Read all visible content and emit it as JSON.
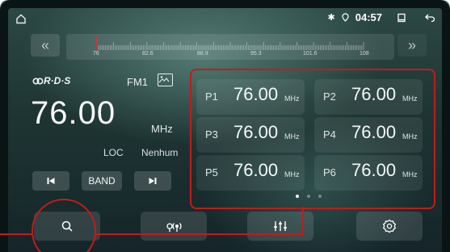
{
  "status": {
    "time": "04:57",
    "icons": [
      "home-icon",
      "bluetooth-icon",
      "location-icon",
      "window-icon",
      "back-icon"
    ]
  },
  "tuner": {
    "scale_labels": [
      "76",
      "82.6",
      "88.9",
      "95.3",
      "101.6",
      "108"
    ],
    "current_marker": 76
  },
  "station": {
    "rds_logo": "RDS",
    "band": "FM1",
    "frequency": "76.00",
    "unit": "MHz",
    "loc": "LOC",
    "ps_name": "Nenhum"
  },
  "controls": {
    "band_label": "BAND"
  },
  "presets": [
    {
      "id": "P1",
      "freq": "76.00",
      "unit": "MHz"
    },
    {
      "id": "P2",
      "freq": "76.00",
      "unit": "MHz"
    },
    {
      "id": "P3",
      "freq": "76.00",
      "unit": "MHz"
    },
    {
      "id": "P4",
      "freq": "76.00",
      "unit": "MHz"
    },
    {
      "id": "P5",
      "freq": "76.00",
      "unit": "MHz"
    },
    {
      "id": "P6",
      "freq": "76.00",
      "unit": "MHz"
    }
  ],
  "page_indicator": {
    "count": 3,
    "active": 1
  },
  "bottom_bar": [
    "search-icon",
    "radio-antenna-icon",
    "equalizer-icon",
    "settings-icon"
  ],
  "colors": {
    "annotation": "#c31b1b",
    "marker": "#e0302c"
  }
}
